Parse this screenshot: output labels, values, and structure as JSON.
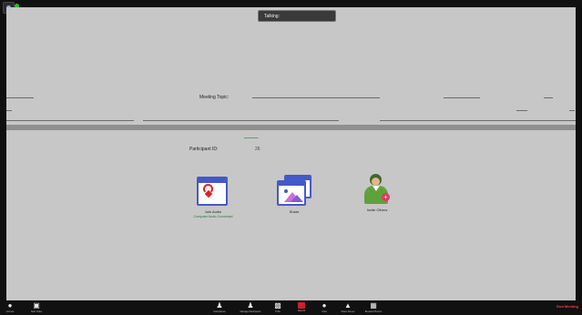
{
  "topbar": {
    "app_icon": "zoom-logo-icon",
    "status_icon": "green-shield-icon"
  },
  "stage": {
    "talking_label": "Talking:",
    "meeting_topic_label": "Meeting Topic:",
    "participant_id_label": "Participant ID:",
    "participant_id_value": "26"
  },
  "actions": [
    {
      "label": "Join Audio",
      "sublabel": "Computer Audio Connected",
      "icon": "headset-icon"
    },
    {
      "label": "Share",
      "sublabel": "",
      "icon": "share-screen-icon"
    },
    {
      "label": "Invite Others",
      "sublabel": "",
      "icon": "invite-person-icon"
    }
  ],
  "toolbar": {
    "items": [
      {
        "icon": "microphone-icon",
        "label": "Unmute"
      },
      {
        "icon": "video-icon",
        "label": "Start Video"
      },
      {
        "icon": "participants-icon",
        "label": "Participants"
      },
      {
        "icon": "manage-participants-icon",
        "label": "Manage Participants"
      },
      {
        "icon": "polling-icon",
        "label": "Polls"
      },
      {
        "icon": "record-icon",
        "label": "Record"
      },
      {
        "icon": "chat-icon",
        "label": "Chat"
      },
      {
        "icon": "share-screen-icon",
        "label": "Share Screen"
      },
      {
        "icon": "breakout-rooms-icon",
        "label": "Breakout Rooms"
      }
    ],
    "end_meeting": "End Meeting"
  },
  "colors": {
    "stage_bg": "#c7c7c7",
    "toolbar_bg": "#111111",
    "accent_blue": "#4459c9",
    "record_red": "#cf1e2a",
    "end_red": "#ff3b3b",
    "green": "#21c12b"
  }
}
